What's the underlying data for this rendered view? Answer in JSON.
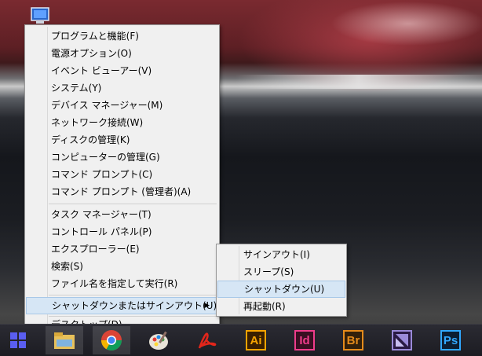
{
  "context_menu": {
    "items": [
      "プログラムと機能(F)",
      "電源オプション(O)",
      "イベント ビューアー(V)",
      "システム(Y)",
      "デバイス マネージャー(M)",
      "ネットワーク接続(W)",
      "ディスクの管理(K)",
      "コンピューターの管理(G)",
      "コマンド プロンプト(C)",
      "コマンド プロンプト (管理者)(A)",
      "タスク マネージャー(T)",
      "コントロール パネル(P)",
      "エクスプローラー(E)",
      "検索(S)",
      "ファイル名を指定して実行(R)",
      "シャットダウンまたはサインアウト(U)",
      "デスクトップ(D)"
    ]
  },
  "submenu": {
    "items": [
      "サインアウト(I)",
      "スリープ(S)",
      "シャットダウン(U)",
      "再起動(R)"
    ]
  },
  "taskbar": {
    "apps": [
      {
        "icon": "file-explorer-icon"
      },
      {
        "icon": "chrome-icon"
      },
      {
        "icon": "paint-icon"
      },
      {
        "icon": "acrobat-icon"
      },
      {
        "icon": "illustrator-icon",
        "label": "Ai",
        "color": "#f7a400",
        "bg": "#3a1f00"
      },
      {
        "icon": "indesign-icon",
        "label": "Id",
        "color": "#ef3c8b",
        "bg": "#3a0f22"
      },
      {
        "icon": "bridge-icon",
        "label": "Br",
        "color": "#e58b1b",
        "bg": "#33200a"
      },
      {
        "icon": "premiere-icon",
        "label": "",
        "color": "#9a8ad8",
        "bg": "#2a1a44"
      },
      {
        "icon": "photoshop-icon",
        "label": "Ps",
        "color": "#31a8ff",
        "bg": "#0b1e33"
      }
    ]
  },
  "colors": {
    "menu_bg": "#f0f0f0",
    "highlight": "#d6e6f5",
    "start_blue": "#5a5ef0"
  }
}
